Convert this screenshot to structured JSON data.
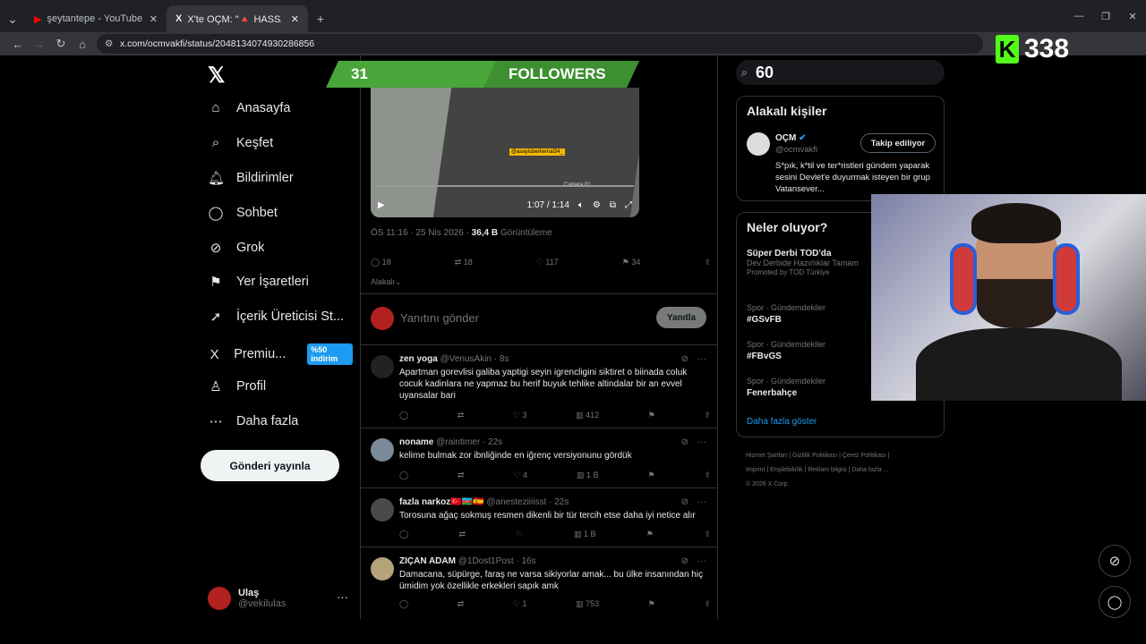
{
  "browser": {
    "tabs": [
      {
        "title": "şeytantepe - YouTube",
        "close": "✕"
      },
      {
        "title": "X'te OÇM: \"🔺 HASSAS 🔺 İna",
        "close": "✕"
      }
    ],
    "new_tab": "+",
    "url": "x.com/ocmvakfi/status/2048134074930286856"
  },
  "stream_overlay": {
    "followers_count": "31",
    "followers_label": "FOLLOWERS",
    "kick_logo": "K",
    "viewer_count": "338"
  },
  "sidebar": {
    "items": [
      {
        "label": "Anasayfa",
        "icon": "⌂"
      },
      {
        "label": "Keşfet",
        "icon": "⌕"
      },
      {
        "label": "Bildirimler",
        "icon": "🔔︎"
      },
      {
        "label": "Sohbet",
        "icon": "◯"
      },
      {
        "label": "Grok",
        "icon": "⊘"
      },
      {
        "label": "Yer İşaretleri",
        "icon": "⚑"
      },
      {
        "label": "İçerik Üreticisi St...",
        "icon": "➚"
      },
      {
        "label": "Premiu...",
        "icon": "X",
        "badge": "%50 indirim"
      },
      {
        "label": "Profil",
        "icon": "♙"
      },
      {
        "label": "Daha fazla",
        "icon": "⋯"
      }
    ],
    "post_button": "Gönderi yayınla",
    "account": {
      "name": "Ulaş",
      "handle": "@vekilulas",
      "menu": "···"
    }
  },
  "tweet": {
    "video_time": "1:07 / 1:14",
    "video_tag": "@asayisberkemal34_",
    "camera_label": "Camera 01",
    "timestamp": "ÖS 11:16 · 25 Nis 2026 · ",
    "views": "36,4 B",
    "views_label": "Görüntüleme",
    "stats": {
      "replies": "18",
      "reposts": "18",
      "likes": "117",
      "bookmarks": "34"
    },
    "sort_label": "Alakalı"
  },
  "reply_box": {
    "placeholder": "Yanıtını gönder",
    "button": "Yanıtla"
  },
  "replies": [
    {
      "name": "zen yoga",
      "handle": "@VenusAkin · 8s",
      "text": "Apartman gorevlisi galiba yaptigi seyin igrencligini siktiret o biinada coluk cocuk kadinlara ne yapmaz bu herif buyuk tehlike altindalar bir an evvel uyansalar bari",
      "likes": "3",
      "views": "412"
    },
    {
      "name": "noname",
      "handle": "@raintimer · 22s",
      "text": "kelime bulmak zor ibnliğinde en iğrenç versiyonunu gördük",
      "likes": "4",
      "views": "1 B"
    },
    {
      "name": "fazla narkoz🇹🇷🇦🇿🇪🇸",
      "handle": "@anesteziiiisst · 22s",
      "text": "Torosuna ağaç sokmuş resmen dikenli bir tür tercih etse daha iyi netice alır",
      "likes": "",
      "views": "1 B"
    },
    {
      "name": "ZIÇAN ADAM",
      "handle": "@1Dost1Post · 16s",
      "text": "Damacana, süpürge, faraş ne varsa sikiyorlar amak... bu ülke insanından hiç ümidim yok özellikle erkekleri sapık amk",
      "likes": "1",
      "views": "753"
    }
  ],
  "right": {
    "search_value": "60",
    "related_title": "Alakalı kişiler",
    "related_person": {
      "name": "OÇM",
      "handle": "@ocmvakfi",
      "bio": "S*pık, k*til ve ter*ristleri gündem yaparak sesini Devlet'e duyurmak isteyen bir grup Vatansever...",
      "button": "Takip ediliyor"
    },
    "trends_title": "Neler oluyor?",
    "trends": [
      {
        "category": "Süper Derbi TOD'da",
        "title": "Dev Derbide Hazırlıklar Tamam",
        "note": "Promoted by TOD Türkiye"
      },
      {
        "category": "Spor · Gündemdekiler",
        "title": "#GSvFB"
      },
      {
        "category": "Spor · Gündemdekiler",
        "title": "#FBvGS"
      },
      {
        "category": "Spor · Gündemdekiler",
        "title": "Fenerbahçe"
      }
    ],
    "show_more": "Daha fazla göster",
    "footer": {
      "line1": "Hizmet Şartları  |  Gizlilik Politikası  |  Çerez Politikası  |",
      "line2": "Imprint  |  Erişilebilirlik  |  Reklam bilgisi  |  Daha fazla ...",
      "line3": "© 2026 X Corp."
    }
  }
}
